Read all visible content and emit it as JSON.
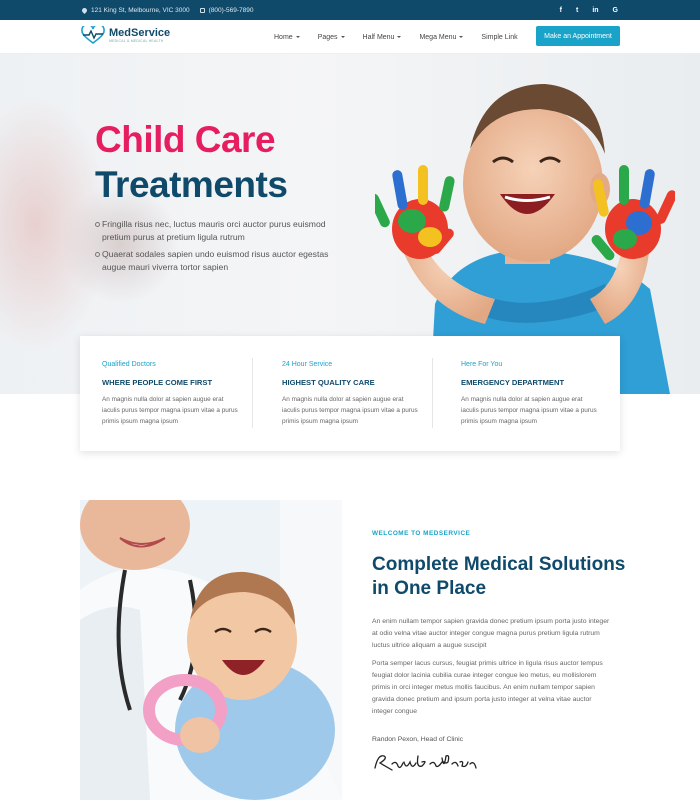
{
  "topbar": {
    "address": "121 King St, Melbourne, VIC 3000",
    "phone": "(800)-569-7890",
    "social": [
      "f",
      "t",
      "in",
      "G"
    ]
  },
  "header": {
    "logo_name": "MedService",
    "logo_tagline": "MEDICAL & MEDICAL HEALTH",
    "nav": [
      "Home",
      "Pages",
      "Half Menu",
      "Mega Menu",
      "Simple Link"
    ],
    "cta": "Make an Appointment"
  },
  "hero": {
    "title_line1": "Child Care",
    "title_line2": "Treatments",
    "bullets": [
      "Fringilla risus nec, luctus mauris orci auctor purus euismod pretium purus at pretium ligula rutrum",
      "Quaerat sodales sapien undo euismod risus auctor egestas augue mauri viverra tortor sapien"
    ]
  },
  "features": [
    {
      "subtitle": "Qualified Doctors",
      "title": "WHERE PEOPLE COME FIRST",
      "text": "An magnis nulla dolor at sapien augue erat iaculis purus tempor magna ipsum vitae a purus primis ipsum magna ipsum"
    },
    {
      "subtitle": "24 Hour Service",
      "title": "HIGHEST QUALITY CARE",
      "text": "An magnis nulla dolor at sapien augue erat iaculis purus tempor magna ipsum vitae a purus primis ipsum magna ipsum"
    },
    {
      "subtitle": "Here For You",
      "title": "EMERGENCY DEPARTMENT",
      "text": "An magnis nulla dolor at sapien augue erat iaculis purus tempor magna ipsum vitae a purus primis ipsum magna ipsum"
    }
  ],
  "about": {
    "label": "WELCOME TO MEDSERVICE",
    "title": "Complete Medical Solutions in One Place",
    "para1": "An enim nullam tempor sapien gravida donec pretium ipsum porta justo integer at odio velna vitae auctor integer congue magna purus pretium ligula rutrum luctus ultrice aliquam a augue suscipit",
    "para2": "Porta semper lacus cursus, feugiat primis ultrice in ligula risus auctor tempus feugiat dolor lacinia cubilia curae integer congue leo metus, eu mollislorem primis in orci integer metus mollis faucibus. An enim nullam tempor sapien gravida donec pretium and ipsum porta justo integer at velna vitae auctor integer congue",
    "signer": "Randon Pexon, Head of Clinic",
    "signature": "Randon Person"
  },
  "colors": {
    "brand": "#0f4a6b",
    "accent": "#1aa3c8",
    "pink": "#e61d5f"
  }
}
